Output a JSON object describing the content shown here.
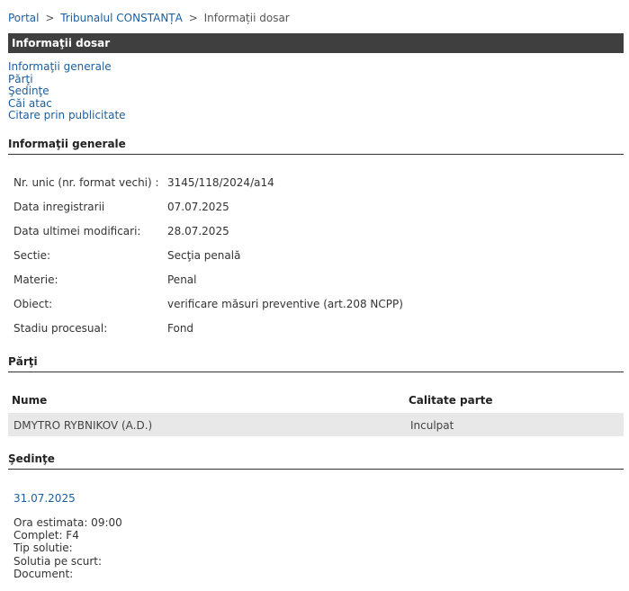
{
  "breadcrumb": {
    "items": [
      "Portal",
      "Tribunalul CONSTANȚA"
    ],
    "separator": ">",
    "current": "Informații dosar"
  },
  "page_title": "Informaţii dosar",
  "nav_links": [
    "Informaţii generale",
    "Părţi",
    "Şedinţe",
    "Căi atac",
    "Citare prin publicitate"
  ],
  "general_info": {
    "heading": "Informaţii generale",
    "rows": [
      {
        "label": "Nr. unic (nr. format vechi) :",
        "value": "3145/118/2024/a14"
      },
      {
        "label": "Data inregistrarii",
        "value": "07.07.2025"
      },
      {
        "label": "Data ultimei modificari:",
        "value": "28.07.2025"
      },
      {
        "label": "Sectie:",
        "value": "Secţia penală"
      },
      {
        "label": "Materie:",
        "value": "Penal"
      },
      {
        "label": "Obiect:",
        "value": "verificare măsuri preventive (art.208 NCPP)"
      },
      {
        "label": "Stadiu procesual:",
        "value": "Fond"
      }
    ]
  },
  "parties": {
    "heading": "Părţi",
    "columns": [
      "Nume",
      "Calitate parte"
    ],
    "rows": [
      {
        "name": "DMYTRO RYBNIKOV (A.D.)",
        "role": "Inculpat"
      }
    ]
  },
  "sessions": {
    "heading": "Şedinţe",
    "date": "31.07.2025",
    "details": [
      "Ora estimata: 09:00",
      "Complet: F4",
      "Tip solutie:",
      "Solutia pe scurt:",
      "Document:"
    ]
  },
  "colors": {
    "link": "#1b5e9e",
    "title_bar": "#3f3f3f",
    "row_highlight": "#e8e8e8"
  }
}
